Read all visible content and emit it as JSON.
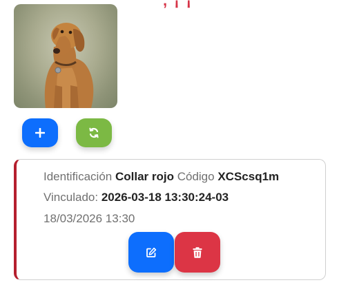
{
  "header": {
    "fragment": ", ¡ ¡"
  },
  "pet": {
    "photo_icon": "dog-photo"
  },
  "actions": {
    "add_icon": "plus-icon",
    "sync_icon": "sync-icon"
  },
  "record": {
    "identification_label": "Identificación",
    "identification_value": "Collar rojo",
    "code_label": "Código",
    "code_value": "XCScsq1m",
    "linked_label": "Vinculado:",
    "linked_value": "2026-03-18 13:30:24-03",
    "date": "18/03/2026 13:30",
    "edit_icon": "edit-icon",
    "delete_icon": "trash-icon"
  },
  "colors": {
    "primary": "#0d6efd",
    "success": "#7cb944",
    "danger": "#dc3545",
    "card_accent": "#b51f2e",
    "header_accent": "#d63447"
  }
}
